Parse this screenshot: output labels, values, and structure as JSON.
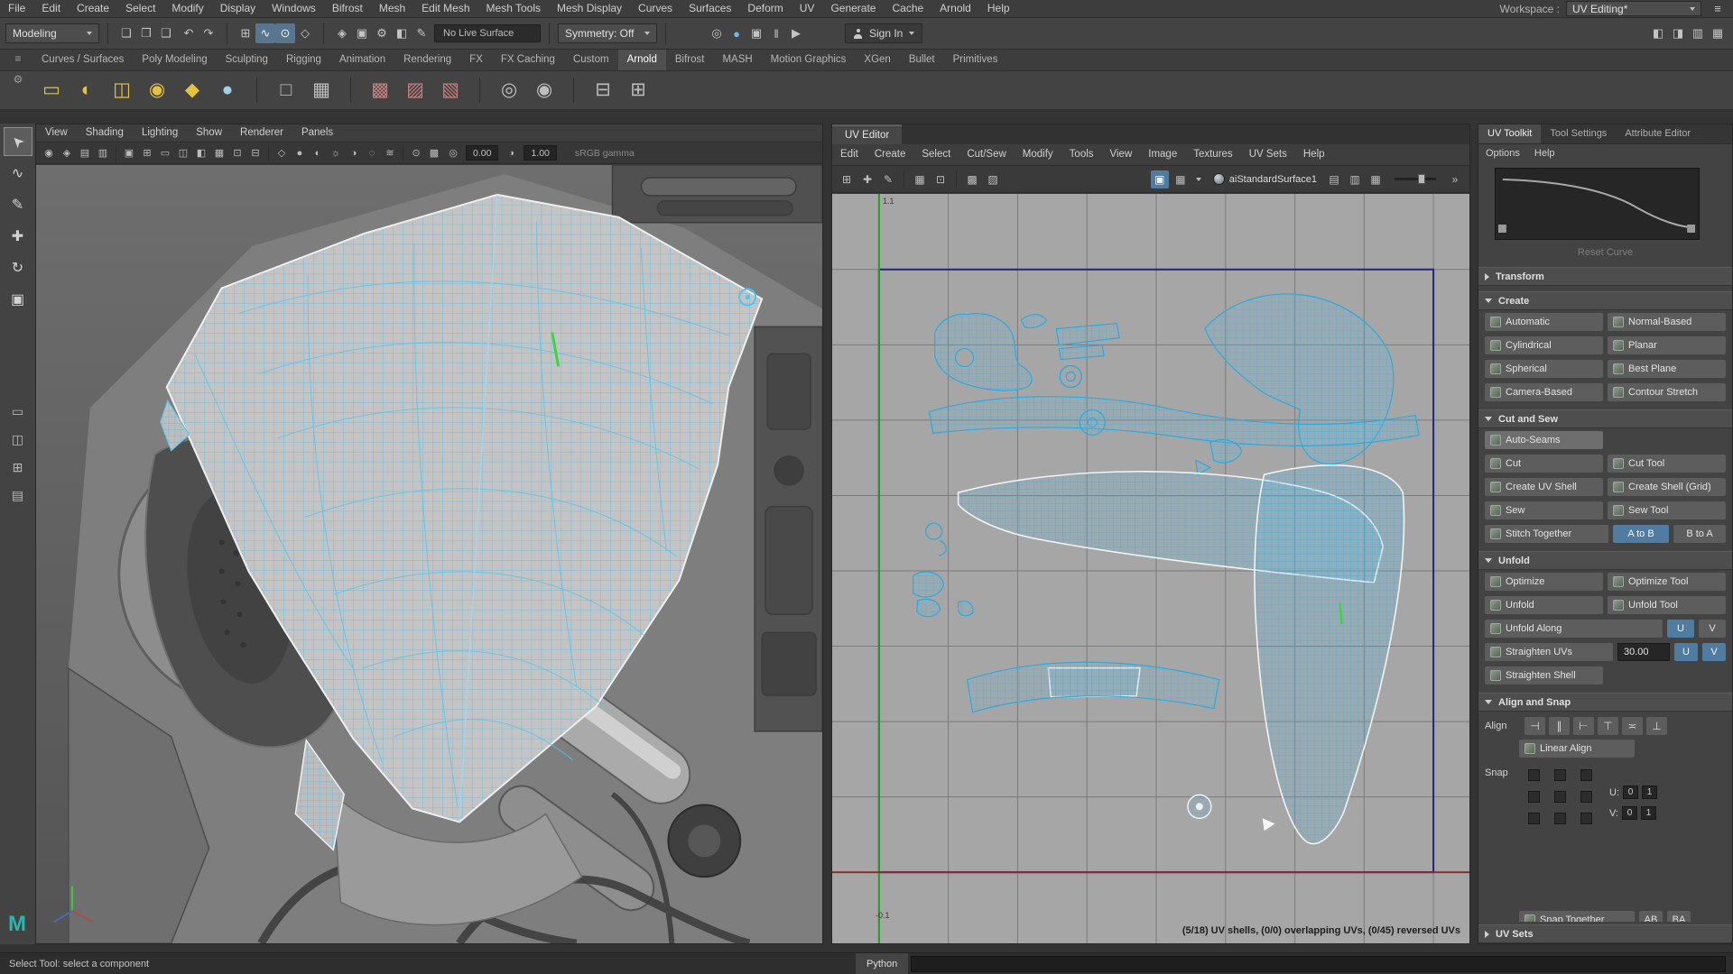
{
  "menubar": {
    "items": [
      "File",
      "Edit",
      "Create",
      "Select",
      "Modify",
      "Display",
      "Windows",
      "Bifrost",
      "Mesh",
      "Edit Mesh",
      "Mesh Tools",
      "Mesh Display",
      "Curves",
      "Surfaces",
      "Deform",
      "UV",
      "Generate",
      "Cache",
      "Arnold",
      "Help"
    ],
    "workspace_label": "Workspace :",
    "workspace_value": "UV Editing*"
  },
  "toolbar": {
    "mode_selector": "Modeling",
    "file_icons": [
      {
        "name": "new-scene-icon",
        "glyph": "❏"
      },
      {
        "name": "open-scene-icon",
        "glyph": "❐"
      },
      {
        "name": "save-scene-icon",
        "glyph": "❑"
      }
    ],
    "edit_icons": [
      {
        "name": "undo-icon",
        "glyph": "↶"
      },
      {
        "name": "redo-icon",
        "glyph": "↷"
      }
    ],
    "snap_icons": [
      {
        "name": "snap-to-grid-icon",
        "glyph": "⊞"
      },
      {
        "name": "snap-to-curve-icon",
        "glyph": "∿",
        "active": true
      },
      {
        "name": "snap-to-point-icon",
        "glyph": "⊙",
        "active": true
      },
      {
        "name": "snap-to-plane-icon",
        "glyph": "◇"
      }
    ],
    "history_icons": [
      {
        "name": "make-live-icon",
        "glyph": "◈"
      },
      {
        "name": "construction-history-icon",
        "glyph": "▣"
      },
      {
        "name": "render-settings-icon",
        "glyph": "⚙"
      },
      {
        "name": "hypershade-icon",
        "glyph": "◧"
      },
      {
        "name": "paint-effects-icon",
        "glyph": "✎"
      }
    ],
    "live_surface": "No Live Surface",
    "symmetry": "Symmetry: Off",
    "render_icons": [
      {
        "name": "render-view-icon",
        "glyph": "◎"
      },
      {
        "name": "ipr-render-icon",
        "glyph": "●",
        "color": "#6fb7e8"
      },
      {
        "name": "render-current-frame-icon",
        "glyph": "▣"
      },
      {
        "name": "pause-icon",
        "glyph": "‖"
      },
      {
        "name": "play-icon",
        "glyph": "▶"
      }
    ],
    "sign_in": "Sign In",
    "right_icons": [
      {
        "name": "single-pane-toggle-icon",
        "glyph": "◧"
      },
      {
        "name": "channel-box-toggle-icon",
        "glyph": "◨"
      },
      {
        "name": "attribute-editor-toggle-icon",
        "glyph": "▥"
      },
      {
        "name": "tool-settings-toggle-icon",
        "glyph": "▦"
      }
    ]
  },
  "shelf": {
    "tabs": [
      {
        "label": "Curves / Surfaces"
      },
      {
        "label": "Poly Modeling"
      },
      {
        "label": "Sculpting"
      },
      {
        "label": "Rigging"
      },
      {
        "label": "Animation"
      },
      {
        "label": "Rendering"
      },
      {
        "label": "FX"
      },
      {
        "label": "FX Caching"
      },
      {
        "label": "Custom"
      },
      {
        "label": "Arnold",
        "active": true
      },
      {
        "label": "Bifrost"
      },
      {
        "label": "MASH"
      },
      {
        "label": "Motion Graphics"
      },
      {
        "label": "XGen"
      },
      {
        "label": "Bullet"
      },
      {
        "label": "Primitives"
      }
    ],
    "icons": [
      {
        "name": "arnold-area-light-icon",
        "glyph": "▭",
        "color": "#e4c23c"
      },
      {
        "name": "arnold-skydome-light-icon",
        "glyph": "◐",
        "color": "#e4c23c"
      },
      {
        "name": "arnold-portal-light-icon",
        "glyph": "◫",
        "color": "#e4c23c"
      },
      {
        "name": "arnold-physical-sky-icon",
        "glyph": "◉",
        "color": "#e4c23c"
      },
      {
        "name": "arnold-photometric-light-icon",
        "glyph": "◆",
        "color": "#e4c23c"
      },
      {
        "name": "arnold-mesh-light-icon",
        "glyph": "●",
        "color": "#9fd0e8"
      },
      {
        "sep": true
      },
      {
        "name": "arnold-standin-icon",
        "glyph": "□",
        "color": "#bdbdbd"
      },
      {
        "name": "arnold-volume-icon",
        "glyph": "▦",
        "color": "#bdbdbd"
      },
      {
        "sep": true
      },
      {
        "name": "arnold-texture-checker-icon",
        "glyph": "▩",
        "color": "#c97f7f"
      },
      {
        "name": "arnold-texture-image-icon",
        "glyph": "▨",
        "color": "#c97f7f"
      },
      {
        "name": "arnold-texture-ramp-icon",
        "glyph": "▧",
        "color": "#c97f7f"
      },
      {
        "sep": true
      },
      {
        "name": "arnold-render-icon",
        "glyph": "◎",
        "color": "#bdbdbd"
      },
      {
        "name": "arnold-ipr-icon",
        "glyph": "◉",
        "color": "#bdbdbd"
      },
      {
        "sep": true
      },
      {
        "name": "arnold-flush-cache-icon",
        "glyph": "⊟",
        "color": "#bdbdbd"
      },
      {
        "name": "arnold-tx-manager-icon",
        "glyph": "⊞",
        "color": "#bdbdbd"
      }
    ]
  },
  "toolbox": {
    "tools": [
      {
        "name": "select-tool-icon",
        "glyph": "➤",
        "cls": "rotul",
        "active": true
      },
      {
        "name": "lasso-select-tool-icon",
        "glyph": "∿"
      },
      {
        "name": "paint-select-tool-icon",
        "glyph": "✎"
      },
      {
        "name": "move-tool-icon",
        "glyph": "✚"
      },
      {
        "name": "rotate-tool-icon",
        "glyph": "↻"
      },
      {
        "name": "scale-tool-icon",
        "glyph": "▣"
      }
    ],
    "layouts": [
      {
        "name": "layout-single-pane-icon",
        "glyph": "▭"
      },
      {
        "name": "layout-two-pane-icon",
        "glyph": "◫"
      },
      {
        "name": "layout-four-pane-icon",
        "glyph": "⊞"
      },
      {
        "name": "layout-outliner-icon",
        "glyph": "▤"
      }
    ]
  },
  "viewport": {
    "menus": [
      "View",
      "Shading",
      "Lighting",
      "Show",
      "Renderer",
      "Panels"
    ],
    "icons": [
      {
        "name": "select-camera-icon",
        "glyph": "◉"
      },
      {
        "name": "lock-camera-icon",
        "glyph": "◈"
      },
      {
        "name": "camera-attributes-icon",
        "glyph": "▤"
      },
      {
        "name": "bookmark-icon",
        "glyph": "▥"
      },
      {
        "sep": true
      },
      {
        "name": "image-plane-icon",
        "glyph": "▣"
      },
      {
        "name": "view-grid-icon",
        "glyph": "⊞"
      },
      {
        "name": "film-gate-icon",
        "glyph": "▭"
      },
      {
        "name": "resolution-gate-icon",
        "glyph": "◫"
      },
      {
        "name": "gate-mask-icon",
        "glyph": "◧"
      },
      {
        "name": "field-chart-icon",
        "glyph": "▦"
      },
      {
        "name": "safe-action-icon",
        "glyph": "⊡"
      },
      {
        "name": "safe-title-icon",
        "glyph": "⊟"
      },
      {
        "sep": true
      },
      {
        "name": "wireframe-icon",
        "glyph": "◇"
      },
      {
        "name": "shaded-icon",
        "glyph": "●"
      },
      {
        "name": "textured-icon",
        "glyph": "◐"
      },
      {
        "name": "lights-icon",
        "glyph": "☼"
      },
      {
        "name": "shadows-icon",
        "glyph": "◑"
      },
      {
        "name": "occlusion-icon",
        "glyph": "◌"
      },
      {
        "name": "motion-blur-icon",
        "glyph": "≋"
      },
      {
        "sep": true
      },
      {
        "name": "isolate-select-icon",
        "glyph": "⊙"
      },
      {
        "name": "xray-icon",
        "glyph": "▩"
      }
    ],
    "exposure": "0.00",
    "gamma": "1.00",
    "colorspace": "sRGB gamma"
  },
  "uv_editor": {
    "title": "UV Editor",
    "menus": [
      "Edit",
      "Create",
      "Select",
      "Cut/Sew",
      "Modify",
      "Tools",
      "View",
      "Image",
      "Textures",
      "UV Sets",
      "Help"
    ],
    "left_icons": [
      {
        "name": "uv-lattice-tool-icon",
        "glyph": "⊞"
      },
      {
        "name": "uv-move-shell-icon",
        "glyph": "✚"
      },
      {
        "name": "uv-smudge-tool-icon",
        "glyph": "✎"
      },
      {
        "sep": true
      },
      {
        "name": "uv-snap-grid-icon",
        "glyph": "▦"
      },
      {
        "name": "uv-pixel-snap-icon",
        "glyph": "⊡"
      },
      {
        "sep": true
      },
      {
        "name": "uv-shell-border-icon",
        "glyph": "▩"
      },
      {
        "name": "uv-shade-shells-icon",
        "glyph": "▨"
      }
    ],
    "isolate_icon": {
      "label": ""
    },
    "right_icons": [
      {
        "name": "uv-texture-checker-icon",
        "glyph": "▤"
      },
      {
        "name": "uv-texture-ramp-icon",
        "glyph": "▥"
      },
      {
        "name": "uv-baked-texture-icon",
        "glyph": "▦"
      }
    ],
    "material": "aiStandardSurface1",
    "label_top": "1.1",
    "label_bottom": "-0.1",
    "status": "(5/18) UV shells, (0/0) overlapping UVs, (0/45) reversed UVs"
  },
  "toolkit": {
    "tabs": [
      {
        "label": "UV Toolkit",
        "active": true
      },
      {
        "label": "Tool Settings"
      },
      {
        "label": "Attribute Editor"
      }
    ],
    "menus": [
      "Options",
      "Help"
    ],
    "reset_curve": "Reset Curve",
    "transform_title": "Transform",
    "create_title": "Create",
    "create": {
      "automatic": "Automatic",
      "normal_based": "Normal-Based",
      "cylindrical": "Cylindrical",
      "planar": "Planar",
      "spherical": "Spherical",
      "best_plane": "Best Plane",
      "camera_based": "Camera-Based",
      "contour_stretch": "Contour Stretch"
    },
    "cutsew_title": "Cut and Sew",
    "cutsew": {
      "auto_seams": "Auto-Seams",
      "cut": "Cut",
      "cut_tool": "Cut Tool",
      "create_uv_shell": "Create UV Shell",
      "create_shell_grid": "Create Shell (Grid)",
      "sew": "Sew",
      "sew_tool": "Sew Tool",
      "stitch_together": "Stitch Together",
      "a_to_b": "A to B",
      "b_to_a": "B to A"
    },
    "unfold_title": "Unfold",
    "unfold": {
      "optimize": "Optimize",
      "optimize_tool": "Optimize Tool",
      "unfold": "Unfold",
      "unfold_tool": "Unfold Tool",
      "unfold_along": "Unfold Along",
      "u": "U",
      "v": "V",
      "straighten_uvs": "Straighten UVs",
      "straighten_value": "30.00",
      "straighten_shell": "Straighten Shell"
    },
    "align_title": "Align and Snap",
    "align": {
      "label": "Align",
      "linear_align": "Linear Align",
      "snap_label": "Snap",
      "u_label": "U:",
      "v_label": "V:",
      "u0": "0",
      "u1": "1",
      "v0": "0",
      "v1": "1",
      "snap_together": "Snap Together",
      "ab": "AB",
      "ba": "BA"
    },
    "align_icons": [
      {
        "name": "align-min-u-icon",
        "glyph": "⊣"
      },
      {
        "name": "align-center-u-icon",
        "glyph": "∥"
      },
      {
        "name": "align-max-u-icon",
        "glyph": "⊢"
      },
      {
        "name": "align-max-v-icon",
        "glyph": "⊤"
      },
      {
        "name": "align-center-v-icon",
        "glyph": "≍"
      },
      {
        "name": "align-min-v-icon",
        "glyph": "⊥"
      }
    ],
    "uvsets_title": "UV Sets"
  },
  "statusbar": {
    "help": "Select Tool: select a component",
    "command_label": "Python"
  }
}
